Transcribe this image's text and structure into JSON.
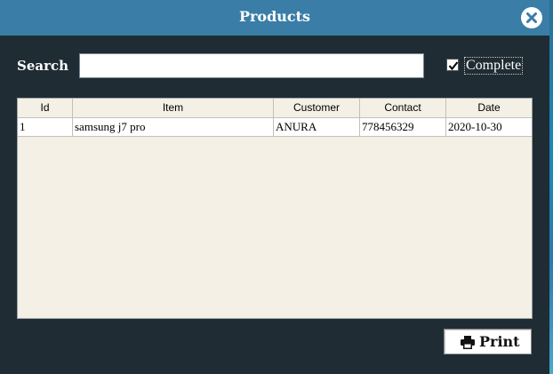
{
  "window": {
    "title": "Products"
  },
  "search": {
    "label": "Search",
    "value": "",
    "placeholder": ""
  },
  "filter": {
    "complete_label": "Complete",
    "complete_checked": true
  },
  "table": {
    "columns": [
      "Id",
      "Item",
      "Customer",
      "Contact",
      "Date"
    ],
    "rows": [
      [
        "1",
        "samsung j7 pro",
        "ANURA",
        "778456329",
        "2020-10-30"
      ]
    ]
  },
  "actions": {
    "print_label": "Print"
  },
  "colors": {
    "titlebar": "#3a7da6",
    "background": "#1f2c33",
    "table_bg": "#f4f0e6"
  },
  "icons": {
    "close": "close-icon",
    "checkmark": "checkmark-icon",
    "print": "printer-icon"
  }
}
